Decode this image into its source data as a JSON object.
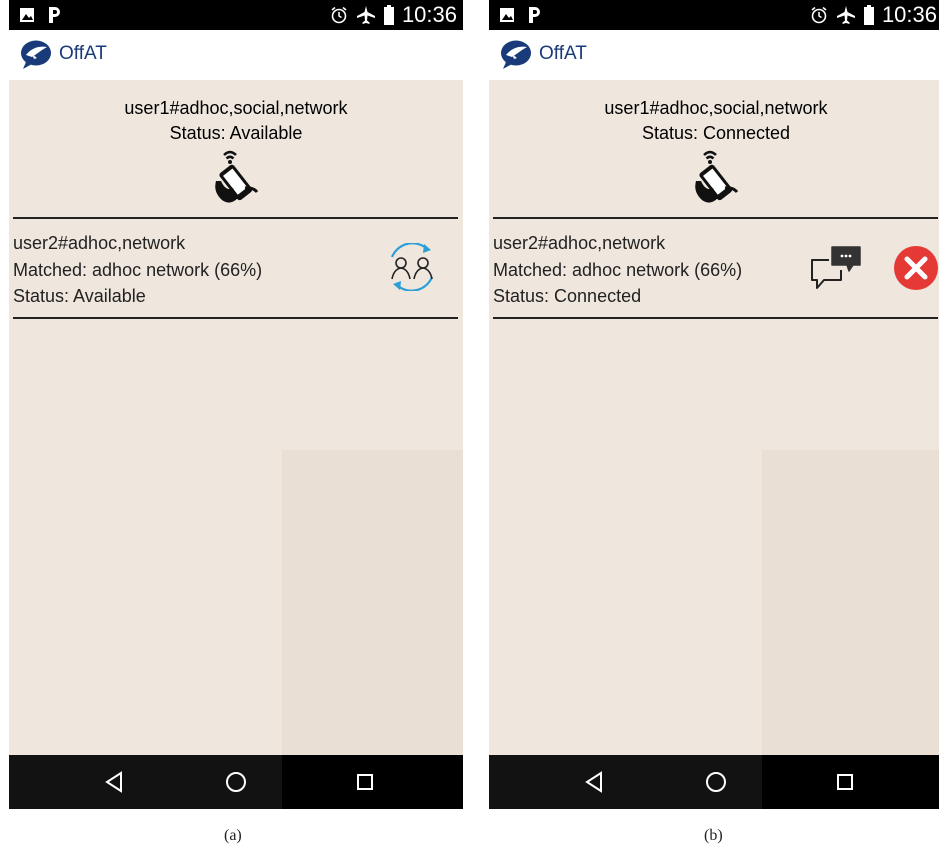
{
  "panels": [
    {
      "status_bar": {
        "time": "10:36",
        "icons": [
          "image-icon",
          "parking-icon",
          "alarm-icon",
          "airplane-icon",
          "battery-icon"
        ]
      },
      "app": {
        "title": "OffAT",
        "logo_icon": "offat-logo-icon"
      },
      "current_user": {
        "name": "user1#adhoc,social,network",
        "status": "Status: Available",
        "icon": "phone-signal-icon"
      },
      "peer": {
        "name": "user2#adhoc,network",
        "matched": "Matched: adhoc network (66%)",
        "status": "Status: Available",
        "actions": [
          "connect-users-icon"
        ]
      },
      "nav": [
        "back-button",
        "home-button",
        "recents-button"
      ],
      "caption": "(a)"
    },
    {
      "status_bar": {
        "time": "10:36",
        "icons": [
          "image-icon",
          "parking-icon",
          "alarm-icon",
          "airplane-icon",
          "battery-icon"
        ]
      },
      "app": {
        "title": "OffAT",
        "logo_icon": "offat-logo-icon"
      },
      "current_user": {
        "name": "user1#adhoc,social,network",
        "status": "Status: Connected",
        "icon": "phone-signal-icon"
      },
      "peer": {
        "name": "user2#adhoc,network",
        "matched": "Matched: adhoc network (66%)",
        "status": "Status: Connected",
        "actions": [
          "chat-icon",
          "disconnect-icon"
        ]
      },
      "nav": [
        "back-button",
        "home-button",
        "recents-button"
      ],
      "caption": "(b)"
    }
  ],
  "colors": {
    "content_bg": "#efe6dd",
    "logo_blue": "#1a3b7a",
    "sync_blue": "#2a9fd6",
    "disconnect_red": "#e53935"
  }
}
